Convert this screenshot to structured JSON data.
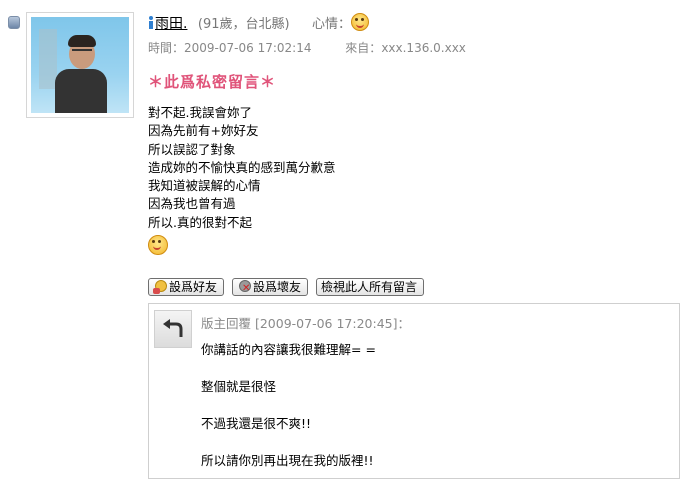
{
  "post": {
    "username": "雨田.",
    "meta": "(91歲，台北縣)",
    "mood_label": "心情：",
    "time_label": "時間：",
    "time": "2009-07-06 17:02:14",
    "from_label": "來自：",
    "ip": "xxx.136.0.xxx",
    "private_notice": "＊此爲私密留言＊",
    "message_lines": [
      "對不起.我誤會妳了",
      "因為先前有+妳好友",
      "所以誤認了對象",
      "造成妳的不愉快真的感到萬分歉意",
      "我知道被誤解的心情",
      "因為我也曾有過",
      "所以.真的很對不起"
    ]
  },
  "buttons": {
    "add_friend": "設爲好友",
    "add_bad": "設爲壞友",
    "view_all": "檢視此人所有留言"
  },
  "reply": {
    "header": "版主回覆 [2009-07-06 17:20:45]：",
    "lines": [
      "你講話的內容讓我很難理解= =",
      "整個就是很怪",
      "不過我還是很不爽!!",
      "所以請你別再出現在我的版裡!!"
    ]
  },
  "icons": {
    "bullet": "bullet-icon",
    "avatar": "avatar-photo",
    "gender": "person-icon",
    "mood": "smiley-icon",
    "friend": "add-friend-icon",
    "bad": "bad-friend-icon",
    "reply": "reply-arrow-icon"
  },
  "colors": {
    "private_notice": "#e0547a",
    "meta_text": "#888888",
    "link_accent": "#2f7fd0"
  }
}
